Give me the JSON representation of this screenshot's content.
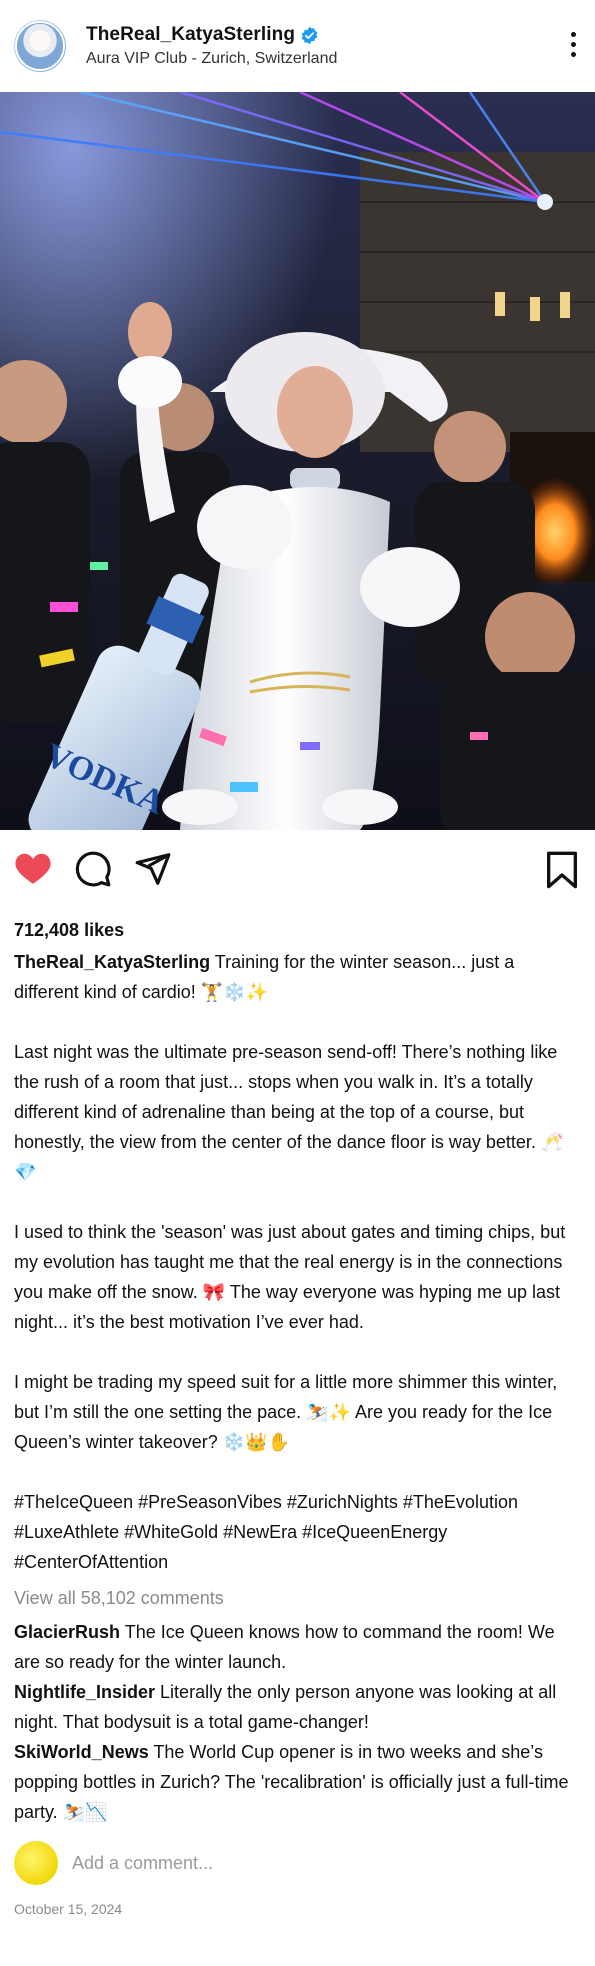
{
  "header": {
    "username": "TheReal_KatyaSterling",
    "location": "Aura VIP Club - Zurich, Switzerland"
  },
  "photo": {
    "bottle_text": "VODKA"
  },
  "actions": {
    "like_icon": "heart-filled-icon",
    "comment_icon": "comment-icon",
    "share_icon": "paper-plane-icon",
    "save_icon": "bookmark-icon",
    "like_color": "#ed4956"
  },
  "likes": "712,408 likes",
  "caption": {
    "username": "TheReal_KatyaSterling",
    "first_line": "Training for the winter season... just a different kind of cardio! 🏋️❄️✨",
    "paragraphs": [
      "Last night was the ultimate pre-season send-off! There’s nothing like the rush of a room that just... stops when you walk in. It’s a totally different kind of adrenaline than being at the top of a course, but honestly, the view from the center of the dance floor is way better. 🥂💎",
      "I used to think the 'season' was just about gates and timing chips, but my evolution has taught me that the real energy is in the connections you make off the snow. 🎀 The way everyone was hyping me up last night... it’s the best motivation I’ve ever had.",
      "I might be trading my speed suit for a little more shimmer this winter, but I’m still the one setting the pace. ⛷️✨ Are you ready for the Ice Queen’s winter takeover? ❄️👑✋",
      "#TheIceQueen #PreSeasonVibes #ZurichNights #TheEvolution #LuxeAthlete #WhiteGold #NewEra #IceQueenEnergy #CenterOfAttention"
    ]
  },
  "view_all": "View all 58,102 comments",
  "comments": [
    {
      "user": "GlacierRush",
      "text": "The Ice Queen knows how to command the room! We are so ready for the winter launch."
    },
    {
      "user": "Nightlife_Insider",
      "text": "Literally the only person anyone was looking at all night. That bodysuit is a total game-changer!"
    },
    {
      "user": "SkiWorld_News",
      "text": "The World Cup opener is in two weeks and she’s popping bottles in Zurich? The 'recalibration' is officially just a full-time party. ⛷️📉"
    }
  ],
  "add_comment_placeholder": "Add a comment...",
  "date": "October 15, 2024"
}
